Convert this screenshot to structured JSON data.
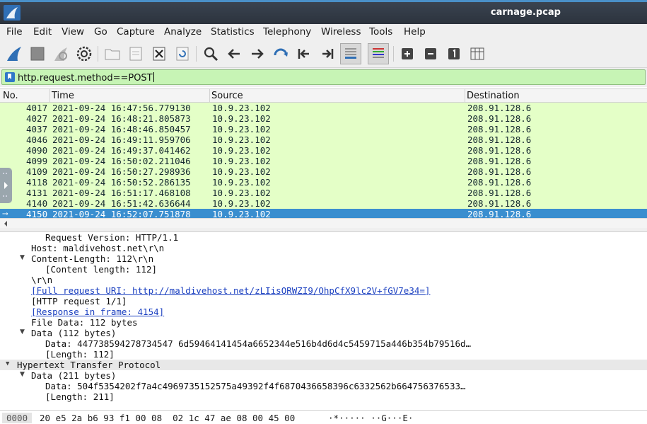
{
  "window": {
    "title": "carnage.pcap"
  },
  "menu": {
    "file": "File",
    "edit": "Edit",
    "view": "View",
    "go": "Go",
    "capture": "Capture",
    "analyze": "Analyze",
    "statistics": "Statistics",
    "telephony": "Telephony",
    "wireless": "Wireless",
    "tools": "Tools",
    "help": "Help"
  },
  "toolbar": {
    "icons": [
      "shark-fin-start-icon",
      "stop-square-icon",
      "restart-fin-icon",
      "capture-options-gear-icon",
      "open-folder-icon",
      "save-file-icon",
      "close-file-icon",
      "reload-file-icon",
      "find-packet-icon",
      "go-back-icon",
      "go-forward-icon",
      "go-to-packet-icon",
      "first-packet-icon",
      "last-packet-icon",
      "autoscroll-icon",
      "colorize-icon",
      "zoom-in-icon",
      "zoom-out-icon",
      "normal-size-icon",
      "resize-columns-icon"
    ]
  },
  "filter": {
    "value": "http.request.method==POST"
  },
  "packet_list": {
    "headers": {
      "no": "No.",
      "time": "Time",
      "source": "Source",
      "destination": "Destination"
    },
    "rows": [
      {
        "no": "4017",
        "time": "2021-09-24 16:47:56.779130",
        "source": "10.9.23.102",
        "destination": "208.91.128.6"
      },
      {
        "no": "4027",
        "time": "2021-09-24 16:48:21.805873",
        "source": "10.9.23.102",
        "destination": "208.91.128.6"
      },
      {
        "no": "4037",
        "time": "2021-09-24 16:48:46.850457",
        "source": "10.9.23.102",
        "destination": "208.91.128.6"
      },
      {
        "no": "4046",
        "time": "2021-09-24 16:49:11.959706",
        "source": "10.9.23.102",
        "destination": "208.91.128.6"
      },
      {
        "no": "4090",
        "time": "2021-09-24 16:49:37.041462",
        "source": "10.9.23.102",
        "destination": "208.91.128.6"
      },
      {
        "no": "4099",
        "time": "2021-09-24 16:50:02.211046",
        "source": "10.9.23.102",
        "destination": "208.91.128.6"
      },
      {
        "no": "4109",
        "time": "2021-09-24 16:50:27.298936",
        "source": "10.9.23.102",
        "destination": "208.91.128.6"
      },
      {
        "no": "4118",
        "time": "2021-09-24 16:50:52.286135",
        "source": "10.9.23.102",
        "destination": "208.91.128.6"
      },
      {
        "no": "4131",
        "time": "2021-09-24 16:51:17.468108",
        "source": "10.9.23.102",
        "destination": "208.91.128.6"
      },
      {
        "no": "4140",
        "time": "2021-09-24 16:51:42.636644",
        "source": "10.9.23.102",
        "destination": "208.91.128.6"
      },
      {
        "no": "4150",
        "time": "2021-09-24 16:52:07.751878",
        "source": "10.9.23.102",
        "destination": "208.91.128.6"
      }
    ],
    "selected_row": "4150",
    "colors": {
      "row_bg": "#e4ffc7",
      "selected_bg": "#3a8ecf"
    }
  },
  "details": {
    "lines": [
      {
        "text": "Request Version: HTTP/1.1"
      },
      {
        "text": "Host: maldivehost.net\\r\\n"
      },
      {
        "text": "Content-Length: 112\\r\\n"
      },
      {
        "text": "[Content length: 112]"
      },
      {
        "text": "\\r\\n"
      },
      {
        "text": "[Full request URI: http://maldivehost.net/zLIisQRWZI9/OhpCfX9lc2V+fGV7e34=]"
      },
      {
        "text": "[HTTP request 1/1]"
      },
      {
        "text": "[Response in frame: 4154]"
      },
      {
        "text": "File Data: 112 bytes"
      },
      {
        "text": "Data (112 bytes)"
      },
      {
        "text": "Data: 447738594278734547 6d59464141454a6652344e516b4d6d4c5459715a446b354b79516d…"
      },
      {
        "text": "[Length: 112]"
      },
      {
        "text": "Hypertext Transfer Protocol"
      },
      {
        "text": "Data (211 bytes)"
      },
      {
        "text": "Data: 504f5354202f7a4c4969735152575a49392f4f6870436658396c6332562b664756376533…"
      },
      {
        "text": "[Length: 211]"
      }
    ]
  },
  "bytes": {
    "offset": "0000",
    "hex": "20 e5 2a b6 93 f1 00 08  02 1c 47 ae 08 00 45 00",
    "ascii": "·*····· ··G···E·"
  }
}
